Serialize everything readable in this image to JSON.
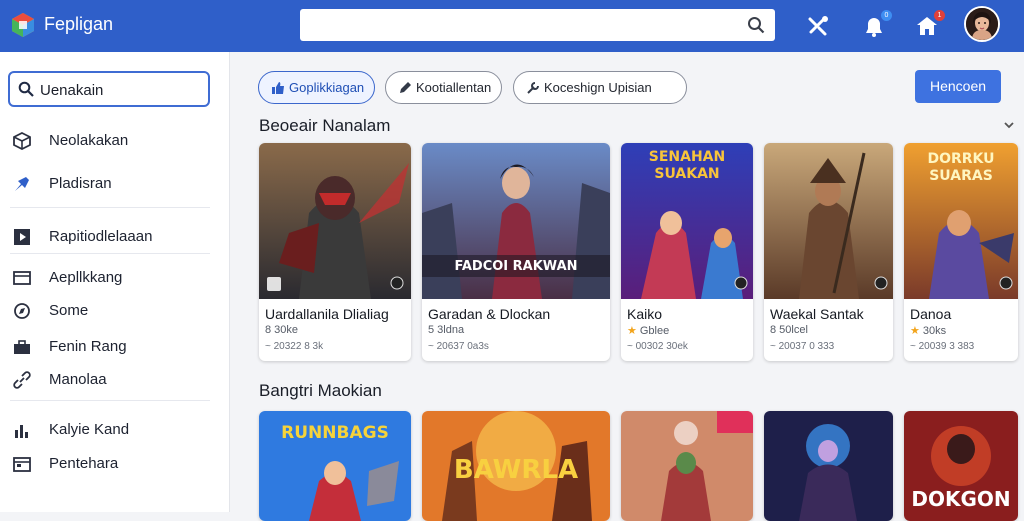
{
  "header": {
    "app_title": "Fepligan",
    "search_placeholder": "",
    "badges": {
      "notifications": "0",
      "alerts": "1"
    }
  },
  "sidebar": {
    "search_value": "Uenakain",
    "items": [
      {
        "label": "Neolakakan",
        "icon": "cube-icon"
      },
      {
        "label": "Pladisran",
        "icon": "pin-icon"
      },
      {
        "label": "Rapitiodlelaaan",
        "icon": "play-square-icon"
      },
      {
        "label": "Aepllkkang",
        "icon": "window-icon"
      },
      {
        "label": "Some",
        "icon": "compass-icon"
      },
      {
        "label": "Fenin Rang",
        "icon": "briefcase-icon"
      },
      {
        "label": "Manolaa",
        "icon": "link-icon"
      },
      {
        "label": "Kalyie Kand",
        "icon": "bar-chart-icon"
      },
      {
        "label": "Pentehara",
        "icon": "calendar-icon"
      }
    ]
  },
  "toolbar": {
    "chips": [
      {
        "label": "Goplikkiagan",
        "active": true
      },
      {
        "label": "Kootiallentan",
        "active": false
      },
      {
        "label": "Koceshign  Upisian",
        "active": false
      }
    ],
    "primary_button": "Hencoen"
  },
  "sections": [
    {
      "title": "Beoeair Nanalam",
      "cards": [
        {
          "title": "Uardallanila Dlialiag",
          "meta": "8 30ke",
          "date": "~ 20322 8 3k",
          "rated": false,
          "caption": ""
        },
        {
          "title": "Garadan & Dlockan",
          "meta": "5 3ldna",
          "date": "~ 20637 0a3s",
          "rated": false,
          "caption": "FADCOI RAKWAN"
        },
        {
          "title": "Kaiko",
          "meta": "Gblee",
          "date": "~ 00302 30ek",
          "rated": true,
          "caption": "SENAHAN SUAKAN"
        },
        {
          "title": "Waekal Santak",
          "meta": "8 50lcel",
          "date": "~ 20037 0 333",
          "rated": false,
          "caption": ""
        },
        {
          "title": "Danoa",
          "meta": "30ks",
          "date": "~ 20039 3 383",
          "rated": true,
          "caption": "DORRKU SUARAS"
        }
      ]
    },
    {
      "title": "Bangtri Maokian",
      "tiles": [
        {
          "caption": "RUNNBAGS"
        },
        {
          "caption": "BAWRLA"
        },
        {
          "caption": ""
        },
        {
          "caption": ""
        },
        {
          "caption": "DOKGON"
        }
      ]
    }
  ],
  "colors": {
    "header_bg": "#2f5fc9",
    "accent": "#3e72e0",
    "star": "#f2a41b"
  }
}
